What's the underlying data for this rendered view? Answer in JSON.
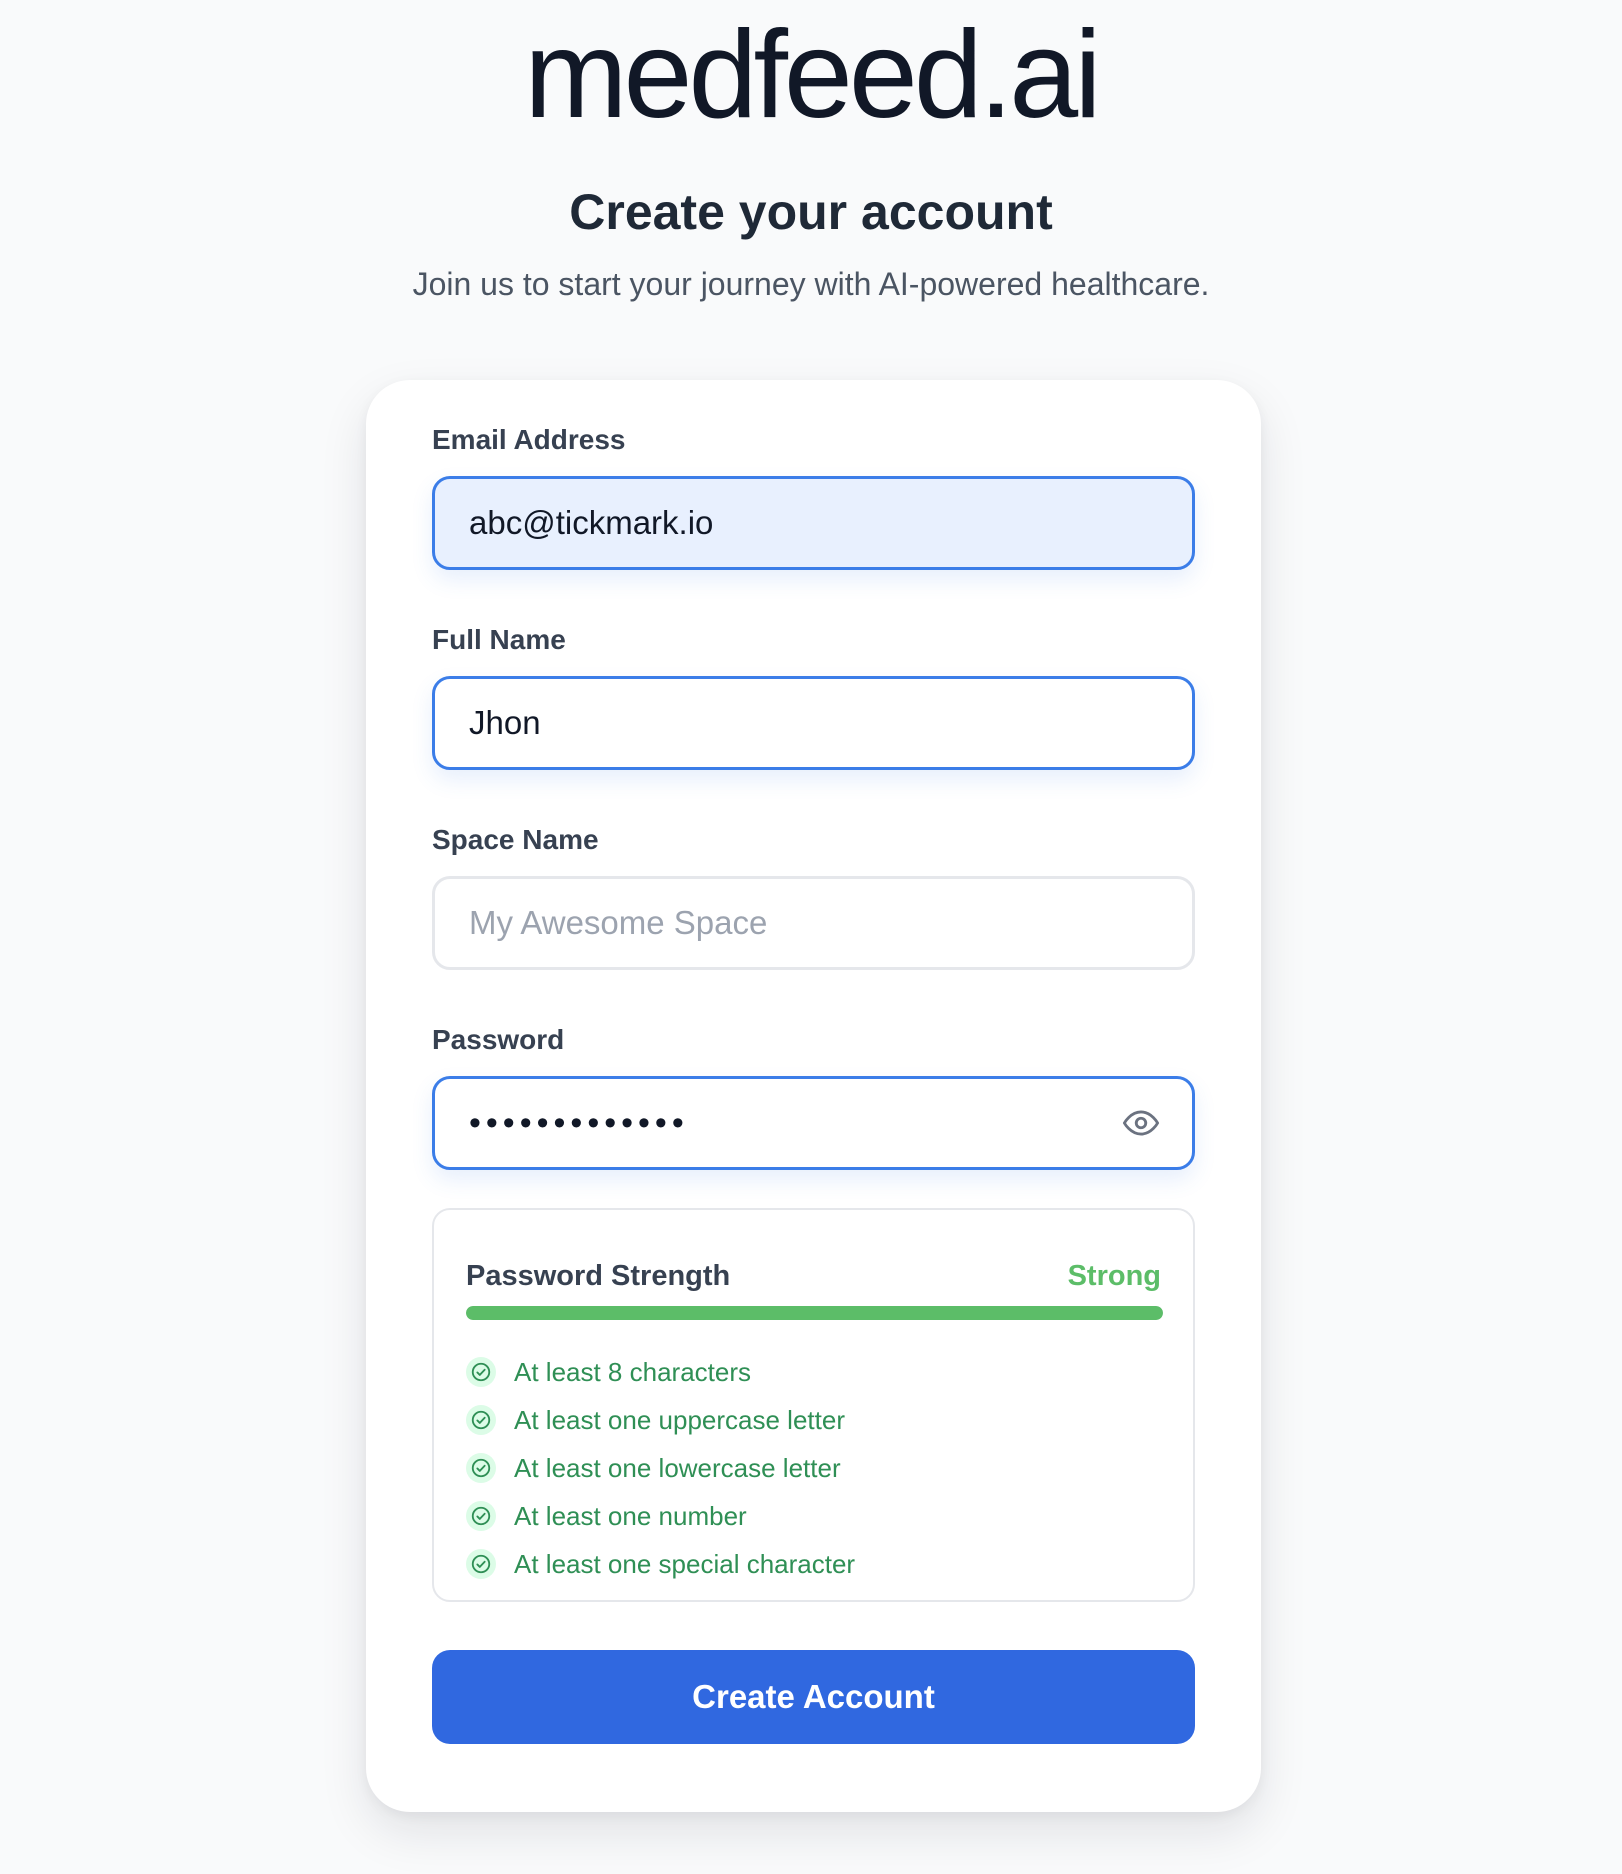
{
  "brand": {
    "logo_text": "medfeed.ai"
  },
  "header": {
    "title": "Create your account",
    "subtitle": "Join us to start your journey with AI-powered healthcare."
  },
  "form": {
    "email": {
      "label": "Email Address",
      "value": "abc@tickmark.io"
    },
    "full_name": {
      "label": "Full Name",
      "value": "Jhon"
    },
    "space_name": {
      "label": "Space Name",
      "placeholder": "My Awesome Space",
      "value": ""
    },
    "password": {
      "label": "Password",
      "masked_value": "•••••••••••••",
      "toggle_icon": "eye-icon"
    },
    "password_strength": {
      "title": "Password Strength",
      "level": "Strong",
      "fill_fraction": 1.0,
      "level_color": "#5cbd68",
      "requirements": [
        {
          "text": "At least 8 characters",
          "met": true
        },
        {
          "text": "At least one uppercase letter",
          "met": true
        },
        {
          "text": "At least one lowercase letter",
          "met": true
        },
        {
          "text": "At least one number",
          "met": true
        },
        {
          "text": "At least one special character",
          "met": true
        }
      ]
    },
    "submit_label": "Create Account"
  },
  "colors": {
    "accent": "#3068e0",
    "focus_border": "#3b7de8",
    "success": "#2f8f55",
    "strength_bar": "#5cbd68"
  }
}
